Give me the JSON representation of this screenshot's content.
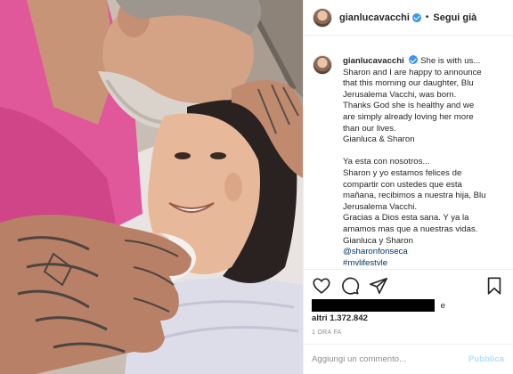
{
  "post": {
    "username": "gianlucavacchi",
    "separator": "•",
    "follow_label": "Segui già"
  },
  "caption": {
    "username": "gianlucavacchi",
    "lines_en": [
      "She is with us...",
      "Sharon and I are happy to announce",
      "that this morning our daughter, Blu",
      "Jerusalema Vacchi, was born.",
      "Thanks God she is healthy and we",
      "are simply already loving her more",
      "than our lives.",
      "Gianluca & Sharon"
    ],
    "lines_es": [
      "Ya esta con nosotros...",
      "Sharon y yo estamos felices de",
      "compartir con ustedes que esta",
      "mañana, recibimos a nuestra hija, Blu",
      "Jerusalema Vacchi.",
      "Gracias a Dios esta sana. Y ya la",
      "amamos mas que a nuestras vidas.",
      "Gianluca y Sharon"
    ],
    "mention": "@sharonfonseca",
    "hashtag": "#mylifestyle"
  },
  "likes": {
    "suffix": "e",
    "others": "altri 1.372.842"
  },
  "timestamp": "1 ORA FA",
  "comment": {
    "placeholder": "Aggiungi un commento...",
    "publish_label": "Pubblica"
  },
  "icons": [
    "heart-icon",
    "comment-icon",
    "share-icon",
    "bookmark-icon",
    "verified-icon"
  ]
}
